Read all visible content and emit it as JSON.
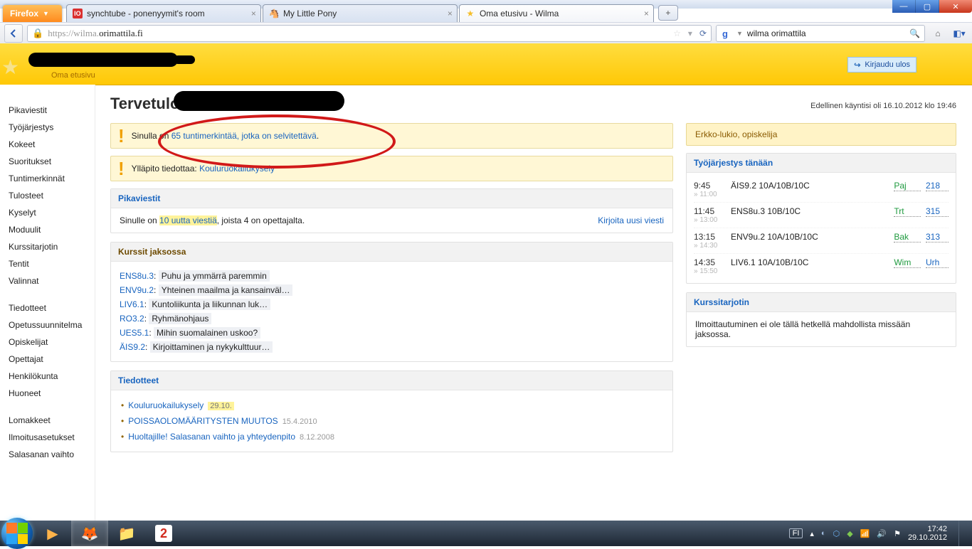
{
  "browser": {
    "name": "Firefox",
    "tabs": [
      {
        "title": "synchtube - ponenyymit's room",
        "favicon": "red-square",
        "active": false
      },
      {
        "title": "My Little Pony",
        "favicon": "pony",
        "active": false
      },
      {
        "title": "Oma etusivu - Wilma",
        "favicon": "star",
        "active": true
      }
    ],
    "url_prefix": "https://wilma.",
    "url_host": "orimattila.fi",
    "search_query": "wilma orimattila"
  },
  "header": {
    "subnav": "Oma etusivu",
    "logout": "Kirjaudu ulos"
  },
  "page": {
    "welcome": "Tervetuloa",
    "last_visit": "Edellinen käyntisi oli 16.10.2012 klo 19:46",
    "alert1_pre": "Sinulla on ",
    "alert1_link": "65 tuntimerkintää, jotka on selvitettävä",
    "alert1_post": ".",
    "alert2_pre": "Ylläpito tiedottaa: ",
    "alert2_link": "Kouluruokailukysely"
  },
  "quickmsg": {
    "title": "Pikaviestit",
    "pre": "Sinulle on ",
    "link": "10 uutta viestiä",
    "post": ", joista 4 on opettajalta.",
    "write": "Kirjoita uusi viesti"
  },
  "courses": {
    "title": "Kurssit jaksossa",
    "list": [
      {
        "code": "ENS8u.3",
        "title": "Puhu ja ymmärrä paremmin"
      },
      {
        "code": "ENV9u.2",
        "title": "Yhteinen maailma ja kansainväl…"
      },
      {
        "code": "LIV6.1",
        "title": "Kuntoliikunta ja liikunnan luk…"
      },
      {
        "code": "RO3.2",
        "title": "Ryhmänohjaus"
      },
      {
        "code": "UES5.1",
        "title": "Mihin suomalainen uskoo?"
      },
      {
        "code": "ÄIS9.2",
        "title": "Kirjoittaminen ja nykykulttuur…"
      }
    ]
  },
  "announcements": {
    "title": "Tiedotteet",
    "list": [
      {
        "title": "Kouluruokailukysely",
        "date": "29.10.",
        "hot": true
      },
      {
        "title": "POISSAOLOMÄÄRITYSTEN MUUTOS",
        "date": "15.4.2010",
        "hot": false
      },
      {
        "title": "Huoltajille! Salasanan vaihto ja yhteydenpito",
        "date": "8.12.2008",
        "hot": false
      }
    ]
  },
  "profile_box": "Erkko-lukio, opiskelija",
  "schedule": {
    "title": "Työjärjestys tänään",
    "rows": [
      {
        "t1": "9:45",
        "t2": "» 11:00",
        "course": "ÄIS9.2 10A/10B/10C",
        "teacher": "Paj",
        "room": "218"
      },
      {
        "t1": "11:45",
        "t2": "» 13:00",
        "course": "ENS8u.3 10B/10C",
        "teacher": "Trt",
        "room": "315"
      },
      {
        "t1": "13:15",
        "t2": "» 14:30",
        "course": "ENV9u.2 10A/10B/10C",
        "teacher": "Bak",
        "room": "313"
      },
      {
        "t1": "14:35",
        "t2": "» 15:50",
        "course": "LIV6.1 10A/10B/10C",
        "teacher": "Wim",
        "room": "Urh"
      }
    ]
  },
  "tray": {
    "title": "Kurssitarjotin",
    "text": "Ilmoittautuminen ei ole tällä hetkellä mahdollista missään jaksossa."
  },
  "sidebar": {
    "g1": [
      "Pikaviestit",
      "Työjärjestys",
      "Kokeet",
      "Suoritukset",
      "Tuntimerkinnät",
      "Tulosteet",
      "Kyselyt",
      "Moduulit",
      "Kurssitarjotin",
      "Tentit",
      "Valinnat"
    ],
    "g2": [
      "Tiedotteet",
      "Opetussuunnitelma",
      "Opiskelijat",
      "Opettajat",
      "Henkilökunta",
      "Huoneet"
    ],
    "g3": [
      "Lomakkeet",
      "Ilmoitusasetukset",
      "Salasanan vaihto"
    ]
  },
  "taskbar": {
    "lang": "FI",
    "time": "17:42",
    "date": "29.10.2012"
  }
}
